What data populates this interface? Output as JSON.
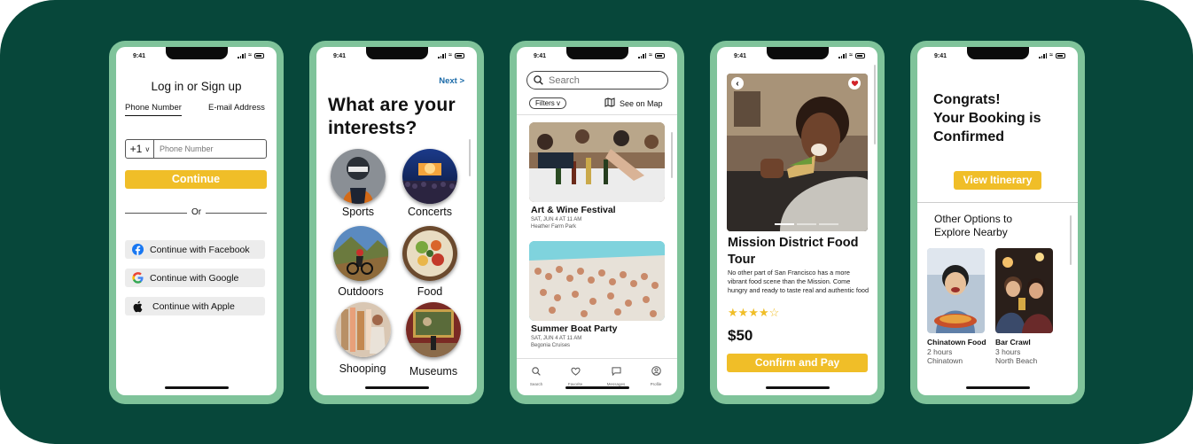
{
  "status_time": "9:41",
  "colors": {
    "background": "#07473a",
    "phone_frame": "#7fc39a",
    "accent_yellow": "#f0be28",
    "link_blue": "#1a6aa8"
  },
  "login": {
    "title": "Log in or Sign up",
    "tab_phone": "Phone Number",
    "tab_email": "E-mail Address",
    "country_code": "+1",
    "country_chevron": "v",
    "phone_placeholder": "Phone Number",
    "continue_label": "Continue",
    "or_label": "Or",
    "facebook_label": "Continue with Facebook",
    "google_label": "Continue with Google",
    "apple_label": "Continue with Apple"
  },
  "interests": {
    "next_label": "Next >",
    "heading_line1": "What are your",
    "heading_line2": "interests?",
    "items": [
      {
        "label": "Sports"
      },
      {
        "label": "Concerts"
      },
      {
        "label": "Outdoors"
      },
      {
        "label": "Food"
      },
      {
        "label": "Shooping"
      },
      {
        "label": "Museums"
      }
    ]
  },
  "search": {
    "placeholder": "Search",
    "filters_label": "Filters v",
    "map_label": "See on Map",
    "events": [
      {
        "title": "Art & Wine Festival",
        "date": "SAT, JUN 4 AT 11 AM",
        "place": "Heather Farm Park"
      },
      {
        "title": "Summer Boat Party",
        "date": "SAT, JUN 4 AT 11 AM",
        "place": "Begonia Cruises"
      }
    ],
    "tabs": [
      {
        "label": "Search",
        "icon": "search-icon"
      },
      {
        "label": "Favorite",
        "icon": "heart-icon"
      },
      {
        "label": "Messages",
        "icon": "message-icon"
      },
      {
        "label": "Profile",
        "icon": "profile-icon"
      }
    ]
  },
  "detail": {
    "title_line1": "Mission District Food",
    "title_line2": "Tour",
    "description": "No other part of San Francisco has a more vibrant food scene than the Mission. Come hungry and ready to taste real and authentic food",
    "rating": 4,
    "rating_max": 5,
    "price": "$50",
    "cta_label": "Confirm and Pay"
  },
  "confirm": {
    "line1": "Congrats!",
    "line2": "Your Booking is",
    "line3": "Confirmed",
    "itinerary_label": "View Itinerary",
    "nearby_line1": "Other Options to",
    "nearby_line2": "Explore Nearby",
    "options": [
      {
        "title": "Chinatown Food",
        "duration": "2 hours",
        "place": "Chinatown"
      },
      {
        "title": "Bar Crawl",
        "duration": "3 hours",
        "place": "North Beach"
      }
    ]
  }
}
